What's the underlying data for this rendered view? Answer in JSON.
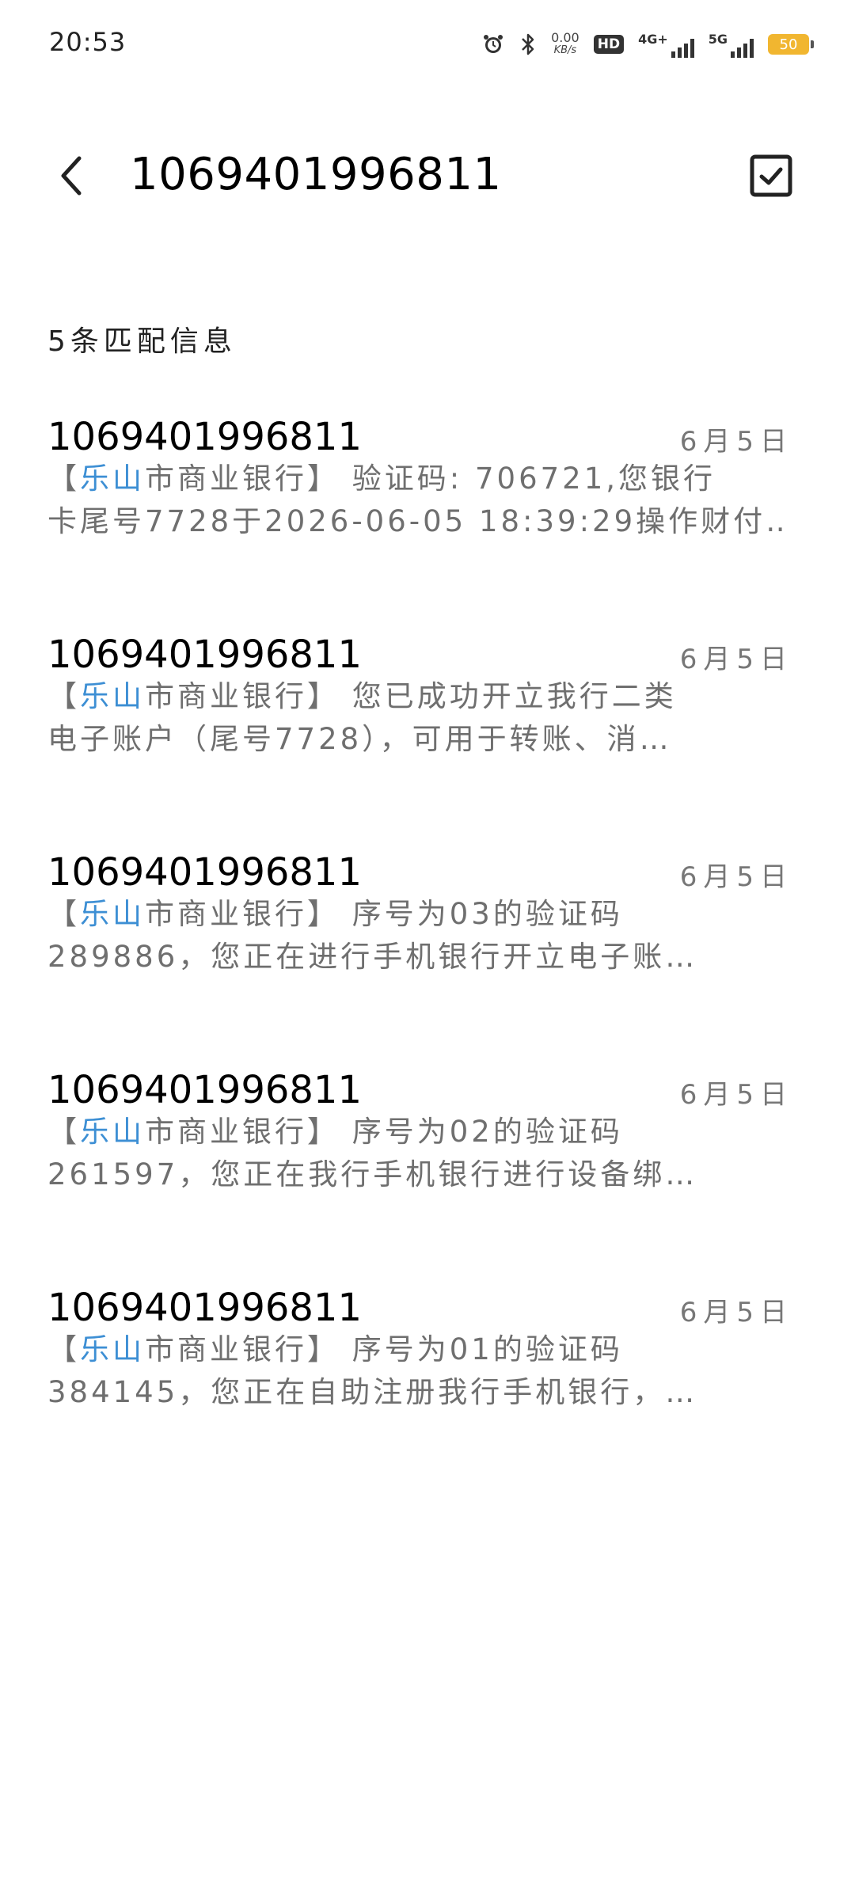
{
  "status_bar": {
    "time": "20:53",
    "speed_value": "0.00",
    "speed_unit": "KB/s",
    "hd_label": "HD",
    "sim1_network": "4G+",
    "sim2_network": "5G",
    "battery": "50"
  },
  "header": {
    "title": "1069401996811"
  },
  "match_count": "5条匹配信息",
  "results": [
    {
      "sender": "1069401996811",
      "date": "6月5日",
      "bracket_open": "【",
      "highlight": "乐山",
      "bank": "市商业银行】",
      "line1_rest": " 验证码: 706721,您银行",
      "line2": "卡尾号7728于2026-06-05 18:39:29操作财付…"
    },
    {
      "sender": "1069401996811",
      "date": "6月5日",
      "bracket_open": "【",
      "highlight": "乐山",
      "bank": "市商业银行】",
      "line1_rest": " 您已成功开立我行二类",
      "line2": "电子账户（尾号7728），可用于转账、消…"
    },
    {
      "sender": "1069401996811",
      "date": "6月5日",
      "bracket_open": "【",
      "highlight": "乐山",
      "bank": "市商业银行】",
      "line1_rest": " 序号为03的验证码",
      "line2": "289886，您正在进行手机银行开立电子账…"
    },
    {
      "sender": "1069401996811",
      "date": "6月5日",
      "bracket_open": "【",
      "highlight": "乐山",
      "bank": "市商业银行】",
      "line1_rest": " 序号为02的验证码",
      "line2": "261597，您正在我行手机银行进行设备绑…"
    },
    {
      "sender": "1069401996811",
      "date": "6月5日",
      "bracket_open": "【",
      "highlight": "乐山",
      "bank": "市商业银行】",
      "line1_rest": " 序号为01的验证码",
      "line2": "384145，您正在自助注册我行手机银行，…"
    }
  ],
  "icons": {
    "back": "chevron-left-icon",
    "select": "checkbox-checked-icon",
    "alarm": "alarm-icon",
    "bluetooth": "bluetooth-icon"
  },
  "colors": {
    "highlight": "#3d8fd4",
    "battery": "#f1b630",
    "snippet_text": "#6f6f6f",
    "date_text": "#777777"
  }
}
